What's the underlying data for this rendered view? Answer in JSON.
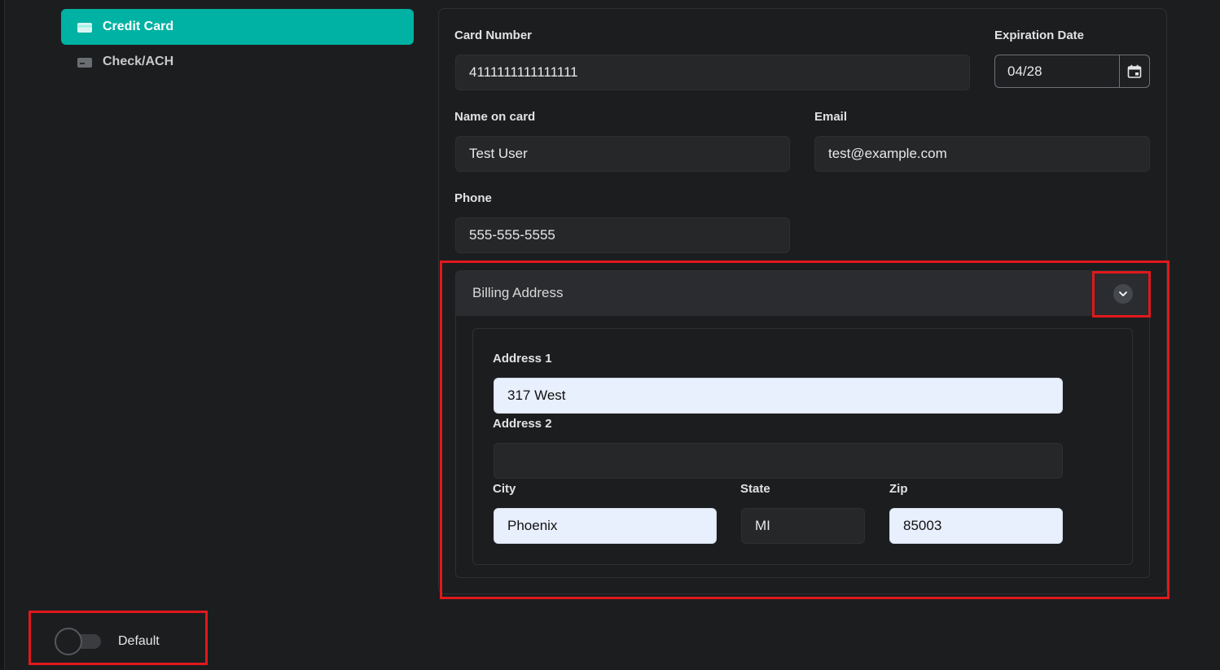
{
  "payment_methods": [
    {
      "label": "Credit Card",
      "icon": "credit-card-icon",
      "active": true
    },
    {
      "label": "Check/ACH",
      "icon": "bank-card-icon",
      "active": false
    }
  ],
  "card_form": {
    "card_number_label": "Card Number",
    "card_number_value": "4111111111111111",
    "expiration_label": "Expiration Date",
    "expiration_value": "04/28",
    "name_label": "Name on card",
    "name_value": "Test User",
    "email_label": "Email",
    "email_value": "test@example.com",
    "phone_label": "Phone",
    "phone_value": "555-555-5555"
  },
  "billing": {
    "title": "Billing Address",
    "expanded": true,
    "address1_label": "Address 1",
    "address1_value": "317 West",
    "address2_label": "Address 2",
    "address2_value": "",
    "city_label": "City",
    "city_value": "Phoenix",
    "state_label": "State",
    "state_value": "MI",
    "zip_label": "Zip",
    "zip_value": "85003"
  },
  "default_toggle": {
    "label": "Default",
    "on": false
  },
  "colors": {
    "accent": "#00b2a3",
    "background": "#1c1d1f",
    "highlight": "#e0181c",
    "autofill_field": "#e8effd"
  }
}
